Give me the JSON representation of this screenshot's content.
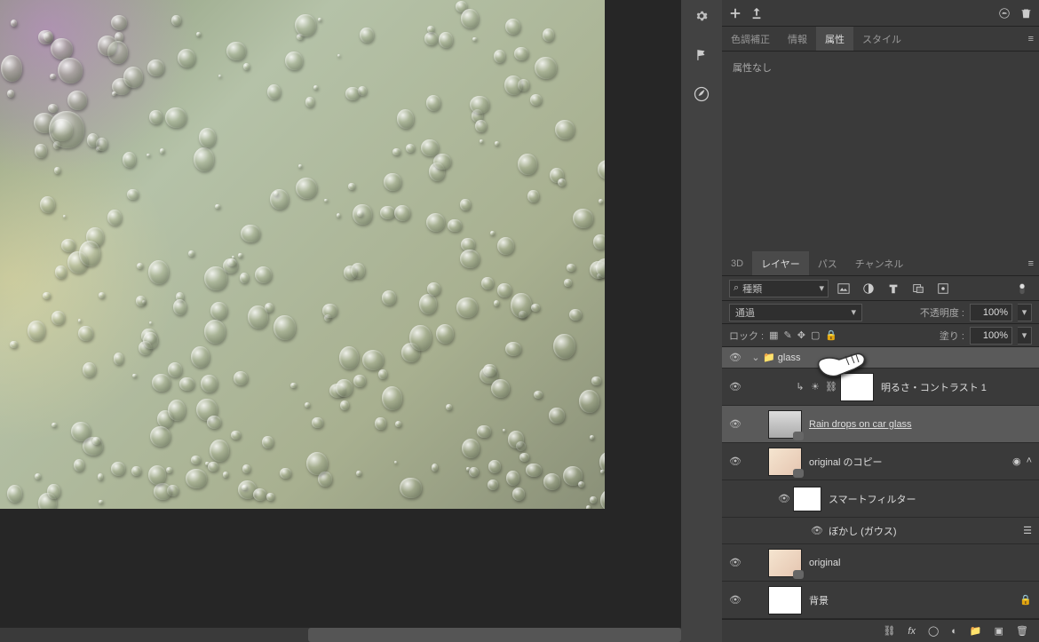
{
  "tabs1": {
    "color": "色調補正",
    "info": "情報",
    "attr": "属性",
    "style": "スタイル"
  },
  "attr_panel": {
    "empty": "属性なし"
  },
  "tabs2": {
    "threeD": "3D",
    "layers": "レイヤー",
    "paths": "パス",
    "channels": "チャンネル"
  },
  "filters": {
    "search_label": "種類"
  },
  "blend": {
    "mode": "通過",
    "opacity_label": "不透明度 :",
    "opacity_val": "100%"
  },
  "lock": {
    "label": "ロック :",
    "fill_label": "塗り :",
    "fill_val": "100%"
  },
  "layers": {
    "glass": "glass",
    "brightcontrast": "明るさ・コントラスト 1",
    "rain": "Rain drops on car glass",
    "origcopy": "original のコピー",
    "smartfilters": "スマートフィルター",
    "gauss": "ぼかし (ガウス)",
    "original": "original",
    "background": "背景"
  }
}
